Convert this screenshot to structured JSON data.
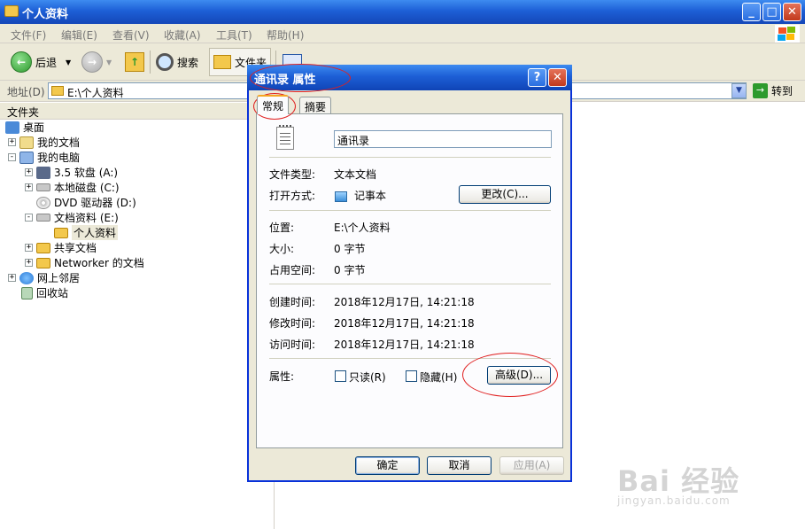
{
  "window": {
    "title": "个人资料"
  },
  "menu": [
    "文件(F)",
    "编辑(E)",
    "查看(V)",
    "收藏(A)",
    "工具(T)",
    "帮助(H)"
  ],
  "toolbar": {
    "back": "后退",
    "search": "搜索",
    "folders": "文件夹"
  },
  "address": {
    "label": "地址(D)",
    "value": "E:\\个人资料",
    "go": "转到"
  },
  "folder_pane": {
    "header": "文件夹",
    "tree": [
      {
        "label": "桌面",
        "icon": "desktop-icon"
      },
      {
        "label": "我的文档",
        "icon": "my-documents-icon"
      },
      {
        "label": "我的电脑",
        "icon": "my-computer-icon"
      },
      {
        "label": "3.5 软盘 (A:)",
        "icon": "floppy-icon"
      },
      {
        "label": "本地磁盘 (C:)",
        "icon": "hard-disk-icon"
      },
      {
        "label": "DVD 驱动器 (D:)",
        "icon": "dvd-drive-icon"
      },
      {
        "label": "文档资料 (E:)",
        "icon": "hard-disk-icon"
      },
      {
        "label": "个人资料",
        "icon": "folder-open-icon"
      },
      {
        "label": "共享文档",
        "icon": "folder-icon"
      },
      {
        "label": "Networker 的文档",
        "icon": "folder-icon"
      },
      {
        "label": "网上邻居",
        "icon": "network-icon"
      },
      {
        "label": "回收站",
        "icon": "recycle-bin-icon"
      }
    ]
  },
  "dialog": {
    "title": "通讯录 属性",
    "tabs": [
      "常规",
      "摘要"
    ],
    "file_name": "通讯录",
    "file_type_label": "文件类型:",
    "file_type": "文本文档",
    "open_with_label": "打开方式:",
    "open_with": "记事本",
    "change_button": "更改(C)...",
    "location_label": "位置:",
    "location": "E:\\个人资料",
    "size_label": "大小:",
    "size": "0 字节",
    "size_on_disk_label": "占用空间:",
    "size_on_disk": "0 字节",
    "created_label": "创建时间:",
    "created": "2018年12月17日, 14:21:18",
    "modified_label": "修改时间:",
    "modified": "2018年12月17日, 14:21:18",
    "accessed_label": "访问时间:",
    "accessed": "2018年12月17日, 14:21:18",
    "attributes_label": "属性:",
    "readonly_label": "只读(R)",
    "hidden_label": "隐藏(H)",
    "advanced_button": "高级(D)...",
    "ok_button": "确定",
    "cancel_button": "取消",
    "apply_button": "应用(A)"
  },
  "watermark": {
    "text": "Bai 经验",
    "url": "jingyan.baidu.com"
  },
  "colors": {
    "titlebar": "#1d5fd6",
    "annotation": "#e02020",
    "dialog_bg": "#ece9d8"
  }
}
